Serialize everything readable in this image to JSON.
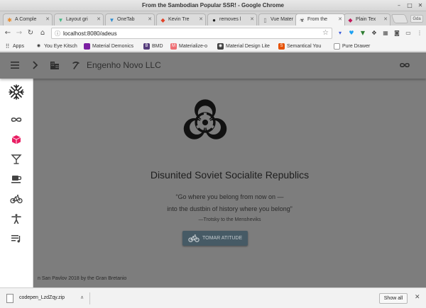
{
  "window": {
    "title": "From the Sambodian Popular SSR! - Google Chrome",
    "minimize": "–",
    "maximize": "□",
    "close": "✕"
  },
  "tabs": [
    {
      "label": "A Comple",
      "favicon": "asterisk-icon",
      "color": "#e88a2a"
    },
    {
      "label": "Layout gri",
      "favicon": "vue-icon",
      "color": "#41b883"
    },
    {
      "label": "OneTab",
      "favicon": "onetab-icon",
      "color": "#2a8bd0"
    },
    {
      "label": "Kevin Tre",
      "favicon": "gitlab-icon",
      "color": "#e24329"
    },
    {
      "label": "removes l",
      "favicon": "github-icon",
      "color": "#222222"
    },
    {
      "label": "Vue Mater",
      "favicon": "page-icon",
      "color": "#777777"
    },
    {
      "label": "From the",
      "favicon": "biohazard-icon",
      "color": "#222222",
      "active": true
    },
    {
      "label": "Plain Tex",
      "favicon": "plain-icon",
      "color": "#c2185b"
    }
  ],
  "profile_label": "Gda",
  "address": {
    "url": "localhost:8080/adeus"
  },
  "bookmarks": {
    "apps_label": "Apps",
    "items": [
      {
        "label": "You Eye Kitsch",
        "icon": "eye-icon",
        "color": "#ffffff",
        "glyph": "👁"
      },
      {
        "label": "Material Demonics",
        "icon": "material-icon",
        "color": "#7b1fa2",
        "glyph": ""
      },
      {
        "label": "BMD",
        "icon": "bootstrap-icon",
        "color": "#563d7c",
        "glyph": "B"
      },
      {
        "label": "Materialize-o",
        "icon": "materialize-icon",
        "color": "#ee6e73",
        "glyph": "M"
      },
      {
        "label": "Material Design Lite",
        "icon": "mdl-icon",
        "color": "#424242",
        "glyph": "◉"
      },
      {
        "label": "Semantical You",
        "icon": "semantic-icon",
        "color": "#e65100",
        "glyph": "S"
      },
      {
        "label": "Pure Drawer",
        "icon": "page-icon",
        "color": "#ffffff",
        "glyph": ""
      }
    ]
  },
  "appbar": {
    "company": "Engenho Novo LLC"
  },
  "rail": {
    "items": [
      {
        "name": "rail-logo-icon"
      },
      {
        "name": "infinity-icon"
      },
      {
        "name": "cube-icon",
        "color": "#e91e63"
      },
      {
        "name": "cocktail-icon"
      },
      {
        "name": "coffee-icon"
      },
      {
        "name": "bike-icon"
      },
      {
        "name": "accessibility-icon"
      },
      {
        "name": "playlist-icon"
      }
    ]
  },
  "main": {
    "headline": "Disunited Soviet Socialite Republics",
    "quote_line1": "“Go where you belong from now on —",
    "quote_line2": "into the dustbin of history where you belong”",
    "attribution": "—Trotsky to the Mensheviks",
    "cta_label": "TOMAR ATITUDE",
    "footer": "n San Pavlov 2018 by the Gran Bretanio"
  },
  "downloads": {
    "file_name": "codepen_LzdZqy.zip",
    "show_all": "Show all"
  },
  "colors": {
    "app_background": "#7d7d7d",
    "cta": "#465a65",
    "rail": "#ffffff"
  }
}
